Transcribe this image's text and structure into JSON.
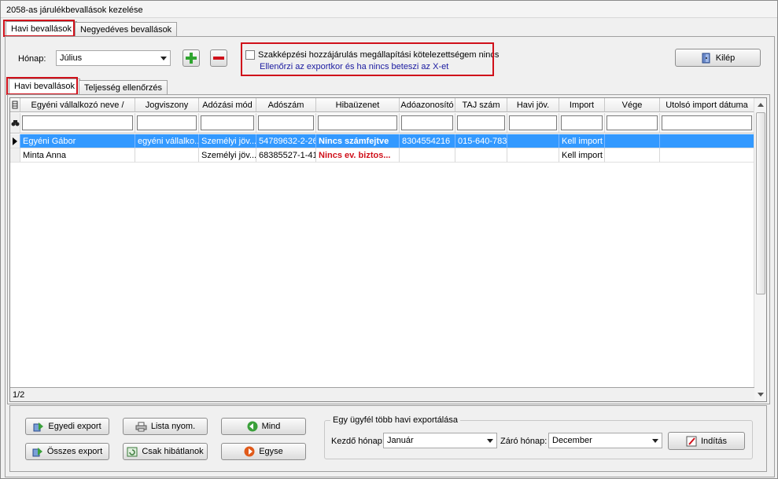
{
  "window": {
    "title": "2058-as járulékbevallások kezelése"
  },
  "tabs_top": [
    {
      "label": "Havi bevallások",
      "active": true
    },
    {
      "label": "Negyedéves bevallások",
      "active": false
    }
  ],
  "controls": {
    "month_label": "Hónap:",
    "month_value": "Július",
    "add_icon": "plus-icon",
    "remove_icon": "minus-icon",
    "checkbox_label": "Szakképzési hozzájárulás megállapítási kötelezettségem nincs",
    "checkbox_checked": false,
    "checkbox_hint": "Ellenőrzi az exportkor és ha nincs beteszi az X-et",
    "exit_label": "Kilép",
    "exit_icon": "door-icon"
  },
  "tabs_inner": [
    {
      "label": "Havi bevallások",
      "active": true
    },
    {
      "label": "Teljesség ellenőrzés",
      "active": false
    }
  ],
  "grid": {
    "columns": [
      "Egyéni vállalkozó neve",
      "Jogviszony",
      "Adózási mód",
      "Adószám",
      "Hibaüzenet",
      "Adóazonosító",
      "TAJ szám",
      "Havi jöv.",
      "Import",
      "Vége",
      "Utolsó import dátuma"
    ],
    "sort_indicator": "/",
    "rows": [
      [
        "Egyéni Gábor",
        "egyéni vállalko...",
        "Személyi jöv...",
        "54789632-2-26",
        "Nincs számfejtve",
        "8304554216",
        "015-640-783",
        "",
        "Kell import",
        "",
        ""
      ],
      [
        "Minta Anna",
        "",
        "Személyi jöv...",
        "68385527-1-41",
        "Nincs ev. biztos...",
        "",
        "",
        "",
        "Kell import",
        "",
        ""
      ]
    ],
    "selected_row": 0,
    "record_indicator": "1/2"
  },
  "buttons": {
    "egyedi_export": "Egyedi export",
    "osszes_export": "Összes export",
    "lista_nyom": "Lista nyom.",
    "csak_hibatlanok": "Csak hibátlanok",
    "mind": "Mind",
    "egyse": "Egyse",
    "inditas": "Indítás"
  },
  "multi_export": {
    "group_title": "Egy ügyfél több havi exportálása",
    "start_label": "Kezdő hónap:",
    "start_value": "Január",
    "end_label": "Záró hónap:",
    "end_value": "December"
  },
  "colors": {
    "highlight": "#d0101a",
    "selection": "#3399ff",
    "error_text": "#d0101a",
    "hint_text": "#1a1aa0"
  }
}
